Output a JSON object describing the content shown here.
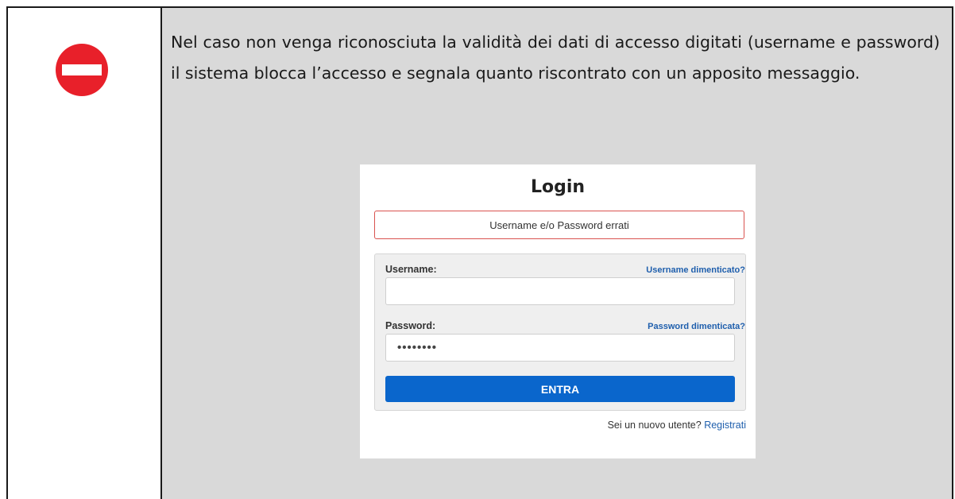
{
  "note": {
    "icon": "no-entry-icon",
    "icon_color": "#e8202a",
    "text": "Nel caso non venga riconosciuta la validità dei dati di accesso digitati (username e password) il sistema blocca l’accesso e segnala quanto riscontrato con un apposito messaggio."
  },
  "login": {
    "title": "Login",
    "error_message": "Username e/o Password errati",
    "username_label": "Username:",
    "username_forgot_link": "Username dimenticato?",
    "username_value": "",
    "password_label": "Password:",
    "password_forgot_link": "Password dimenticata?",
    "password_value": "••••••••",
    "submit_label": "ENTRA",
    "register_prompt": "Sei un nuovo utente?",
    "register_link": "Registrati",
    "accent_color": "#0a66cc",
    "error_border_color": "#d9534f"
  }
}
